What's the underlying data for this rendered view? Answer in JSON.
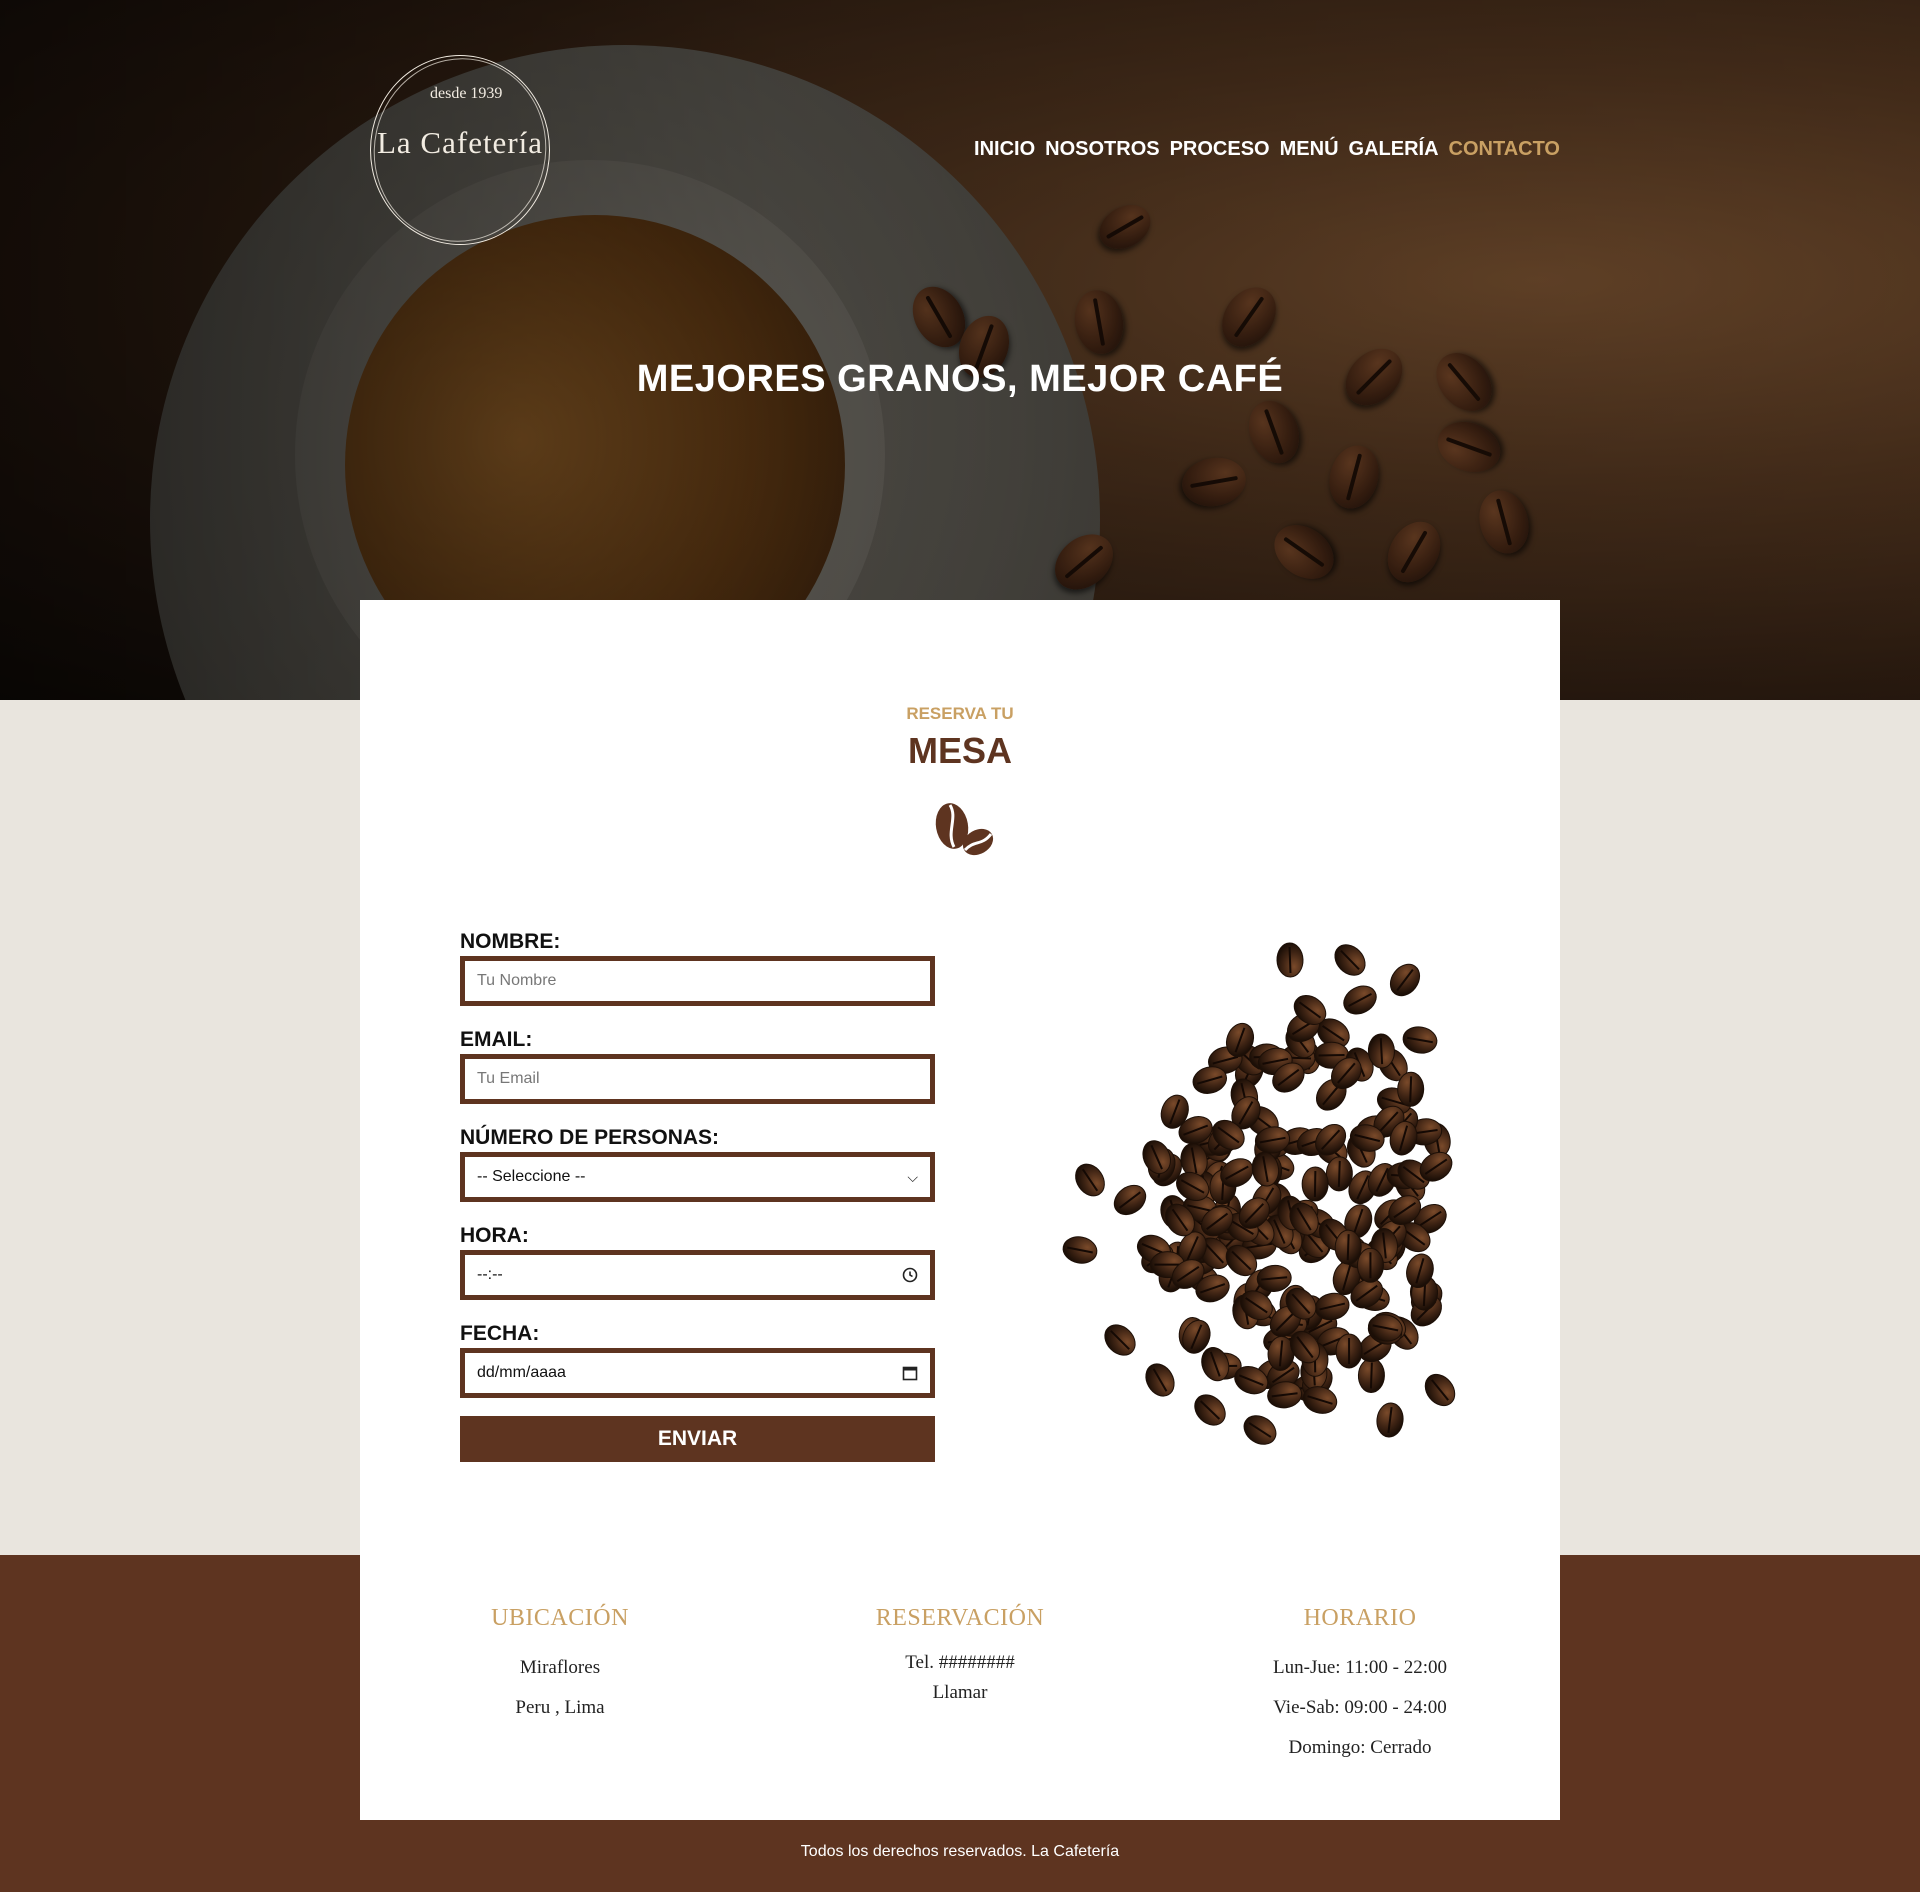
{
  "brand": {
    "since": "desde 1939",
    "name": "La Cafetería"
  },
  "nav": {
    "items": [
      {
        "label": "INICIO"
      },
      {
        "label": "NOSOTROS"
      },
      {
        "label": "PROCESO"
      },
      {
        "label": "MENÚ"
      },
      {
        "label": "GALERÍA"
      },
      {
        "label": "CONTACTO"
      }
    ],
    "active": "CONTACTO"
  },
  "hero": {
    "title": "MEJORES GRANOS, MEJOR CAFÉ"
  },
  "reservation": {
    "eyebrow": "RESERVA TU",
    "title": "MESA",
    "icon": "coffee-beans-icon",
    "form": {
      "name_label": "NOMBRE:",
      "name_placeholder": "Tu Nombre",
      "email_label": "EMAIL:",
      "email_placeholder": "Tu Email",
      "people_label": "NÚMERO DE PERSONAS:",
      "people_selected": "-- Seleccione --",
      "time_label": "HORA:",
      "time_value": "--:--",
      "date_label": "FECHA:",
      "date_value": "dd/mm/aaaa",
      "submit_label": "ENVIAR"
    }
  },
  "info": {
    "location": {
      "title": "UBICACIÓN",
      "line1": "Miraflores",
      "line2": "Peru , Lima"
    },
    "booking": {
      "title": "RESERVACIÓN",
      "phone": "Tel. ########",
      "call": "Llamar"
    },
    "hours": {
      "title": "HORARIO",
      "line1": "Lun-Jue: 11:00 - 22:00",
      "line2": "Vie-Sab: 09:00 - 24:00",
      "line3": "Domingo: Cerrado"
    }
  },
  "footer": {
    "copyright": "Todos los derechos reservados. La Cafetería"
  },
  "colors": {
    "accent": "#c9a063",
    "brown": "#5e3420",
    "page_bg": "#e9e5de"
  }
}
